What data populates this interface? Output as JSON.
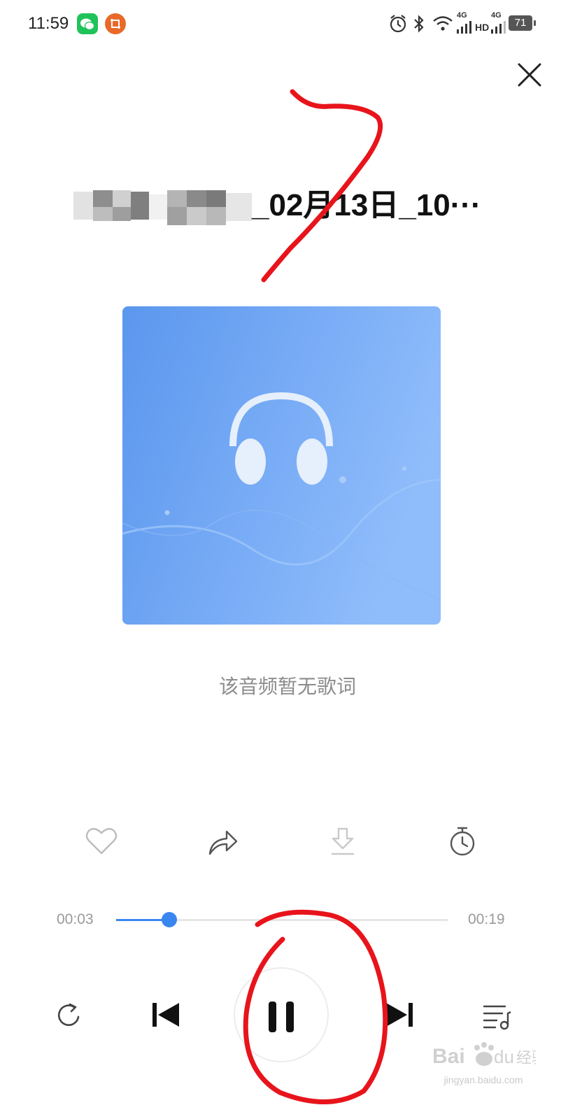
{
  "status_bar": {
    "time": "11:59",
    "network_1": "4G",
    "hd": "HD",
    "network_2": "4G",
    "battery": "71"
  },
  "player": {
    "title": "_02月13日_10···",
    "lyrics_empty_message": "该音频暂无歌词",
    "current_time": "00:03",
    "total_time": "00:19",
    "progress": 0.16,
    "is_playing": true
  },
  "colors": {
    "accent": "#3a86f0",
    "annotation": "#e8141b",
    "album_gradient_start": "#5b97ee",
    "album_gradient_end": "#8fbcfb"
  },
  "icons": {
    "close": "close-icon",
    "like": "heart-icon",
    "share": "share-icon",
    "download": "download-icon",
    "timer": "timer-icon",
    "repeat": "repeat-icon",
    "previous": "skip-previous-icon",
    "pause": "pause-icon",
    "next": "skip-next-icon",
    "playlist": "playlist-icon"
  },
  "watermark": {
    "brand": "Baidu经验",
    "url": "jingyan.baidu.com"
  }
}
